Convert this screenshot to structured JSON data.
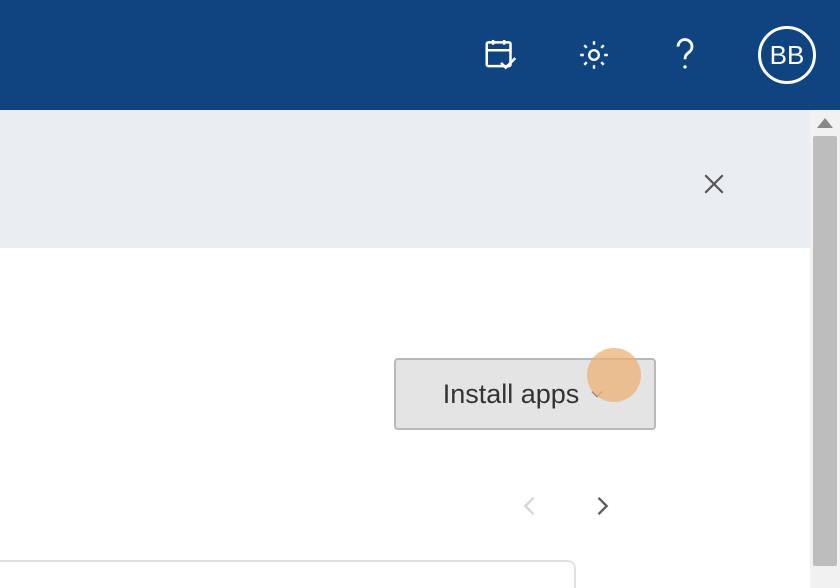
{
  "header": {
    "icons": {
      "calendar": "calendar-check-icon",
      "settings": "gear-icon",
      "help": "help-icon"
    },
    "avatar_initials": "BB"
  },
  "banner": {
    "close_label": "close"
  },
  "install_button": {
    "label": "Install apps"
  },
  "nav": {
    "prev_enabled": false,
    "next_enabled": true
  },
  "highlight": {
    "target": "install-apps-dropdown"
  }
}
